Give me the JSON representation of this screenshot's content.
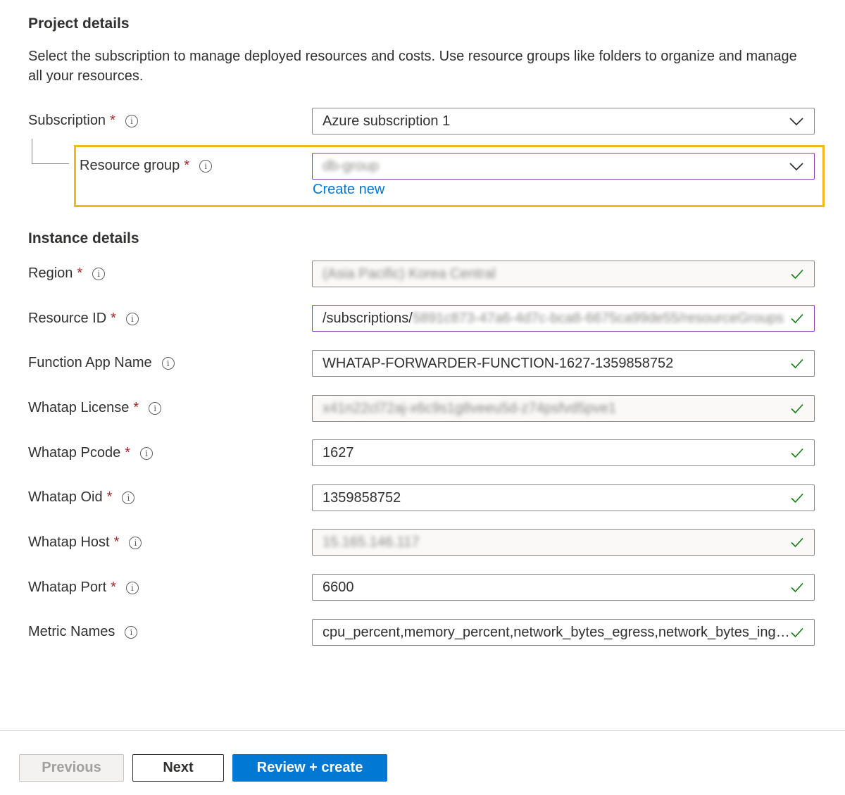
{
  "project_details": {
    "title": "Project details",
    "description": "Select the subscription to manage deployed resources and costs. Use resource groups like folders to organize and manage all your resources."
  },
  "subscription": {
    "label": "Subscription",
    "required": "*",
    "value": "Azure subscription 1"
  },
  "resource_group": {
    "label": "Resource group",
    "required": "*",
    "value": "db-group",
    "create_new": "Create new"
  },
  "instance_details": {
    "title": "Instance details"
  },
  "region": {
    "label": "Region",
    "required": "*",
    "value": "(Asia Pacific) Korea Central"
  },
  "resource_id": {
    "label": "Resource ID",
    "required": "*",
    "value_prefix": "/subscriptions/",
    "value_hidden": "5891c873-47a6-4d7c-bca8-6675ca99de55/resourceGroups"
  },
  "function_app_name": {
    "label": "Function App Name",
    "value": "WHATAP-FORWARDER-FUNCTION-1627-1359858752"
  },
  "whatap_license": {
    "label": "Whatap License",
    "required": "*",
    "value": "x41n22cl72aj-x6c9s1g8veeu5d-z74psfvd5pve1"
  },
  "whatap_pcode": {
    "label": "Whatap Pcode",
    "required": "*",
    "value": "1627"
  },
  "whatap_oid": {
    "label": "Whatap Oid",
    "required": "*",
    "value": "1359858752"
  },
  "whatap_host": {
    "label": "Whatap Host",
    "required": "*",
    "value": "15.165.146.117"
  },
  "whatap_port": {
    "label": "Whatap Port",
    "required": "*",
    "value": "6600"
  },
  "metric_names": {
    "label": "Metric Names",
    "value": "cpu_percent,memory_percent,network_bytes_egress,network_bytes_ingress"
  },
  "footer": {
    "previous": "Previous",
    "next": "Next",
    "review_create": "Review + create"
  },
  "colors": {
    "accent": "#0078d4",
    "required": "#a4262c",
    "valid": "#107c10",
    "highlight": "#f2b81a",
    "focus": "#8a3fb8"
  },
  "icons": {
    "info": "info-icon",
    "dropdown": "chevron-down-icon",
    "valid": "checkmark-icon"
  }
}
